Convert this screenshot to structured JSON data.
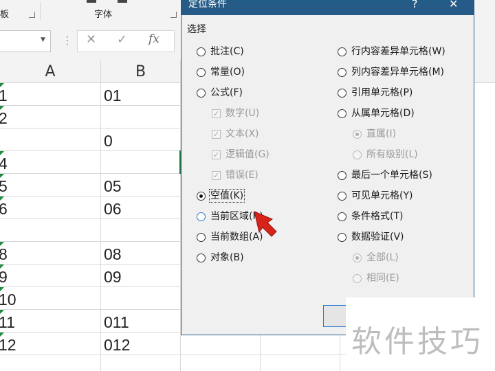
{
  "ribbon": {
    "left_group_label": "板",
    "font_group_label": "字体"
  },
  "formula_bar": {
    "cancel_symbol": "✕",
    "enter_symbol": "✓",
    "fx_label": "fx",
    "more_symbol": "⋮"
  },
  "columns": [
    "A",
    "B"
  ],
  "rows": [
    {
      "num": "1",
      "b": "01"
    },
    {
      "num": "2",
      "b": ""
    },
    {
      "num": "",
      "b": "0"
    },
    {
      "num": "4",
      "b": ""
    },
    {
      "num": "5",
      "b": "05"
    },
    {
      "num": "6",
      "b": "06"
    },
    {
      "num": "",
      "b": ""
    },
    {
      "num": "8",
      "b": "08"
    },
    {
      "num": "9",
      "b": "09"
    },
    {
      "num": "10",
      "b": ""
    },
    {
      "num": "11",
      "b": "011"
    },
    {
      "num": "12",
      "b": "012"
    }
  ],
  "dialog": {
    "title": "定位条件",
    "help": "?",
    "close": "✕",
    "group_label": "选择",
    "left_options": [
      {
        "label": "批注(C)"
      },
      {
        "label": "常量(O)"
      },
      {
        "label": "公式(F)"
      },
      {
        "label": "数字(U)"
      },
      {
        "label": "文本(X)"
      },
      {
        "label": "逻辑值(G)"
      },
      {
        "label": "错误(E)"
      },
      {
        "label": "空值(K)"
      },
      {
        "label": "当前区域(R)"
      },
      {
        "label": "当前数组(A)"
      },
      {
        "label": "对象(B)"
      }
    ],
    "right_options": [
      {
        "label": "行内容差异单元格(W)"
      },
      {
        "label": "列内容差异单元格(M)"
      },
      {
        "label": "引用单元格(P)"
      },
      {
        "label": "从属单元格(D)"
      },
      {
        "label": "直属(I)"
      },
      {
        "label": "所有级别(L)"
      },
      {
        "label": "最后一个单元格(S)"
      },
      {
        "label": "可见单元格(Y)"
      },
      {
        "label": "条件格式(T)"
      },
      {
        "label": "数据验证(V)"
      },
      {
        "label": "全部(L)"
      },
      {
        "label": "相同(E)"
      }
    ],
    "selected": "空值(K)"
  },
  "watermark": {
    "text": "软件技巧"
  },
  "colors": {
    "title_bar": "#255b86",
    "accent": "#2a7ad3",
    "pointer": "#d8231a",
    "marker": "#1e8a3e"
  }
}
